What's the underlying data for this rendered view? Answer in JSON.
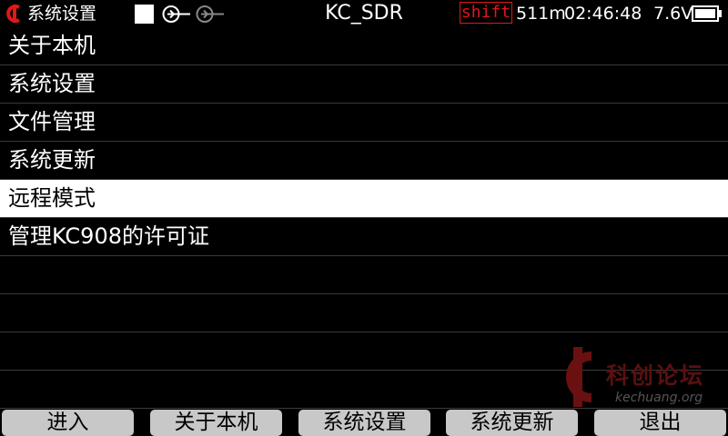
{
  "status_bar": {
    "title": "系统设置",
    "device_name": "KC_SDR",
    "shift_label": "shift",
    "memory": "511m",
    "time": "02:46:48",
    "voltage": "7.6V",
    "icons": [
      "kc-logo-icon",
      "record-square-icon",
      "antenna-active-icon",
      "antenna-inactive-icon",
      "battery-icon"
    ],
    "shift_color": "#e01818"
  },
  "menu": {
    "items": [
      {
        "label": "关于本机",
        "selected": false
      },
      {
        "label": "系统设置",
        "selected": false
      },
      {
        "label": "文件管理",
        "selected": false
      },
      {
        "label": "系统更新",
        "selected": false
      },
      {
        "label": "远程模式",
        "selected": true
      },
      {
        "label": "管理KC908的许可证",
        "selected": false
      }
    ],
    "empty_rows": 4
  },
  "watermark": {
    "text": "科创论坛",
    "url": "kechuang.org"
  },
  "softkeys": [
    {
      "label": "进入"
    },
    {
      "label": "关于本机"
    },
    {
      "label": "系统设置"
    },
    {
      "label": "系统更新"
    },
    {
      "label": "退出"
    }
  ]
}
